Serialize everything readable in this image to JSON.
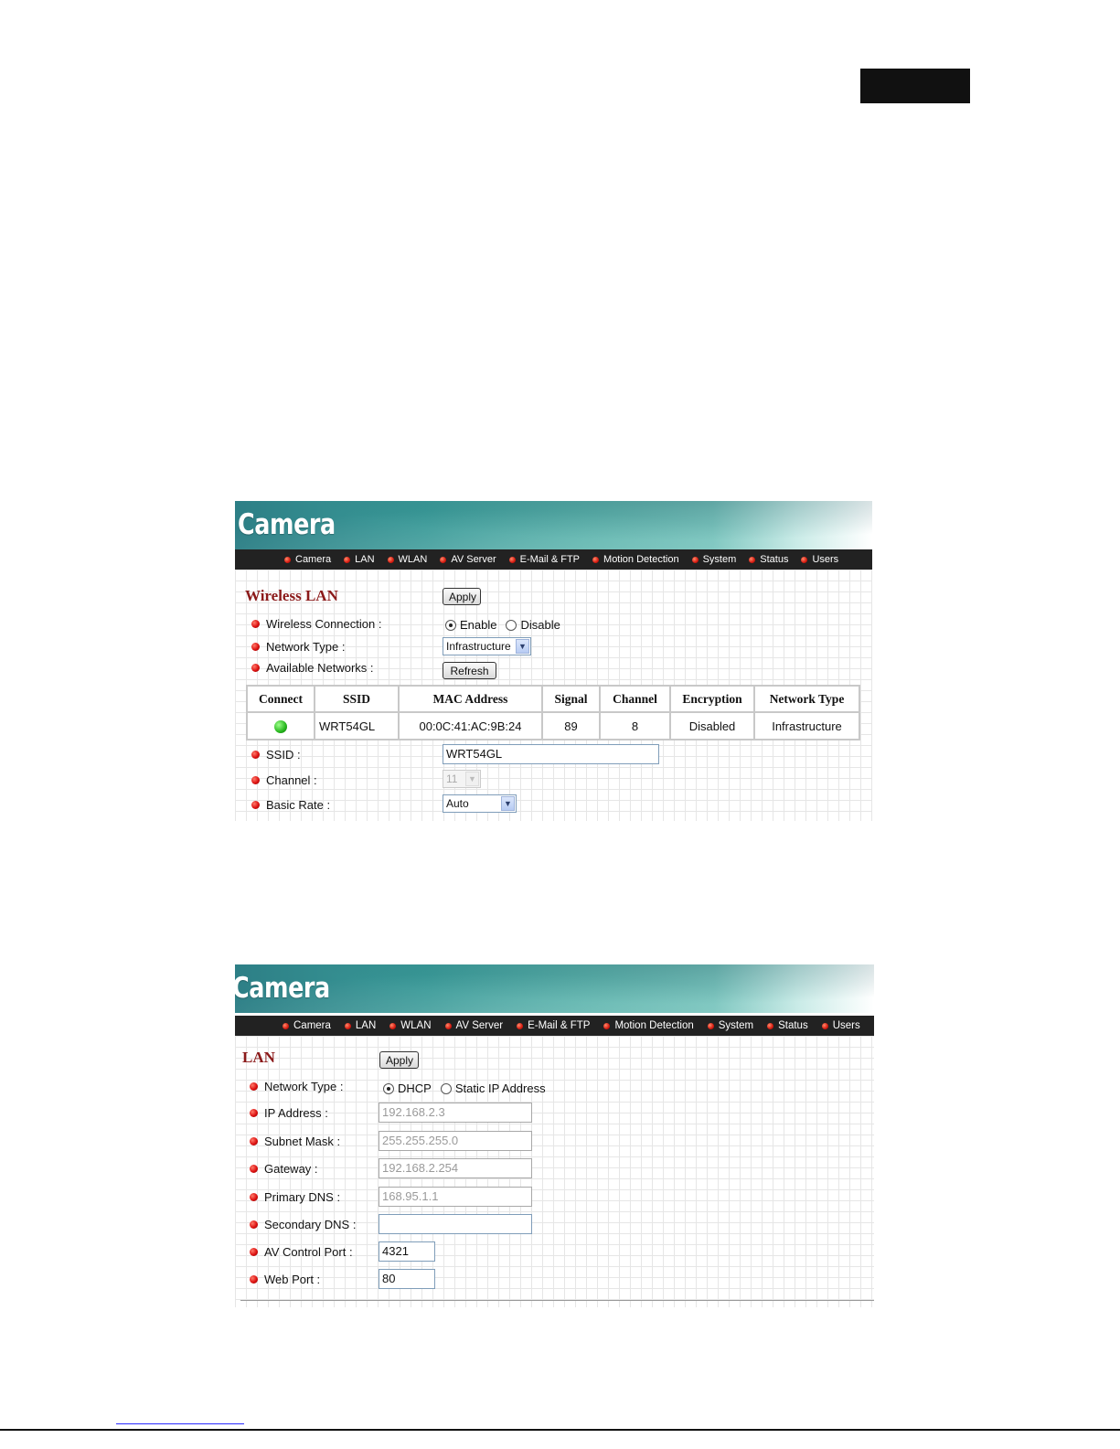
{
  "wlan_panel": {
    "logo": "Camera",
    "nav": [
      "Camera",
      "LAN",
      "WLAN",
      "AV Server",
      "E-Mail & FTP",
      "Motion Detection",
      "System",
      "Status",
      "Users"
    ],
    "title": "Wireless LAN",
    "apply_label": "Apply",
    "wireless_connection": {
      "label": "Wireless Connection :",
      "options": [
        "Enable",
        "Disable"
      ],
      "selected": "Enable"
    },
    "network_type": {
      "label": "Network Type :",
      "value": "Infrastructure"
    },
    "available_networks": {
      "label": "Available Networks :",
      "refresh_label": "Refresh"
    },
    "table": {
      "headers": [
        "Connect",
        "SSID",
        "MAC Address",
        "Signal",
        "Channel",
        "Encryption",
        "Network Type"
      ],
      "row": {
        "ssid": "WRT54GL",
        "mac": "00:0C:41:AC:9B:24",
        "signal": "89",
        "channel": "8",
        "encryption": "Disabled",
        "network_type": "Infrastructure"
      }
    },
    "ssid": {
      "label": "SSID :",
      "value": "WRT54GL"
    },
    "channel": {
      "label": "Channel :",
      "value": "11"
    },
    "basic_rate": {
      "label": "Basic Rate :",
      "value": "Auto"
    }
  },
  "lan_panel": {
    "logo": "Camera",
    "nav": [
      "Camera",
      "LAN",
      "WLAN",
      "AV Server",
      "E-Mail & FTP",
      "Motion Detection",
      "System",
      "Status",
      "Users"
    ],
    "title": "LAN",
    "apply_label": "Apply",
    "network_type": {
      "label": "Network Type :",
      "options": [
        "DHCP",
        "Static IP Address"
      ],
      "selected": "DHCP"
    },
    "ip_address": {
      "label": "IP Address :",
      "value": "192.168.2.3"
    },
    "subnet_mask": {
      "label": "Subnet Mask :",
      "value": "255.255.255.0"
    },
    "gateway": {
      "label": "Gateway :",
      "value": "192.168.2.254"
    },
    "primary_dns": {
      "label": "Primary DNS :",
      "value": "168.95.1.1"
    },
    "secondary_dns": {
      "label": "Secondary DNS :",
      "value": ""
    },
    "av_control_port": {
      "label": "AV Control Port :",
      "value": "4321"
    },
    "web_port": {
      "label": "Web Port :",
      "value": "80"
    }
  }
}
